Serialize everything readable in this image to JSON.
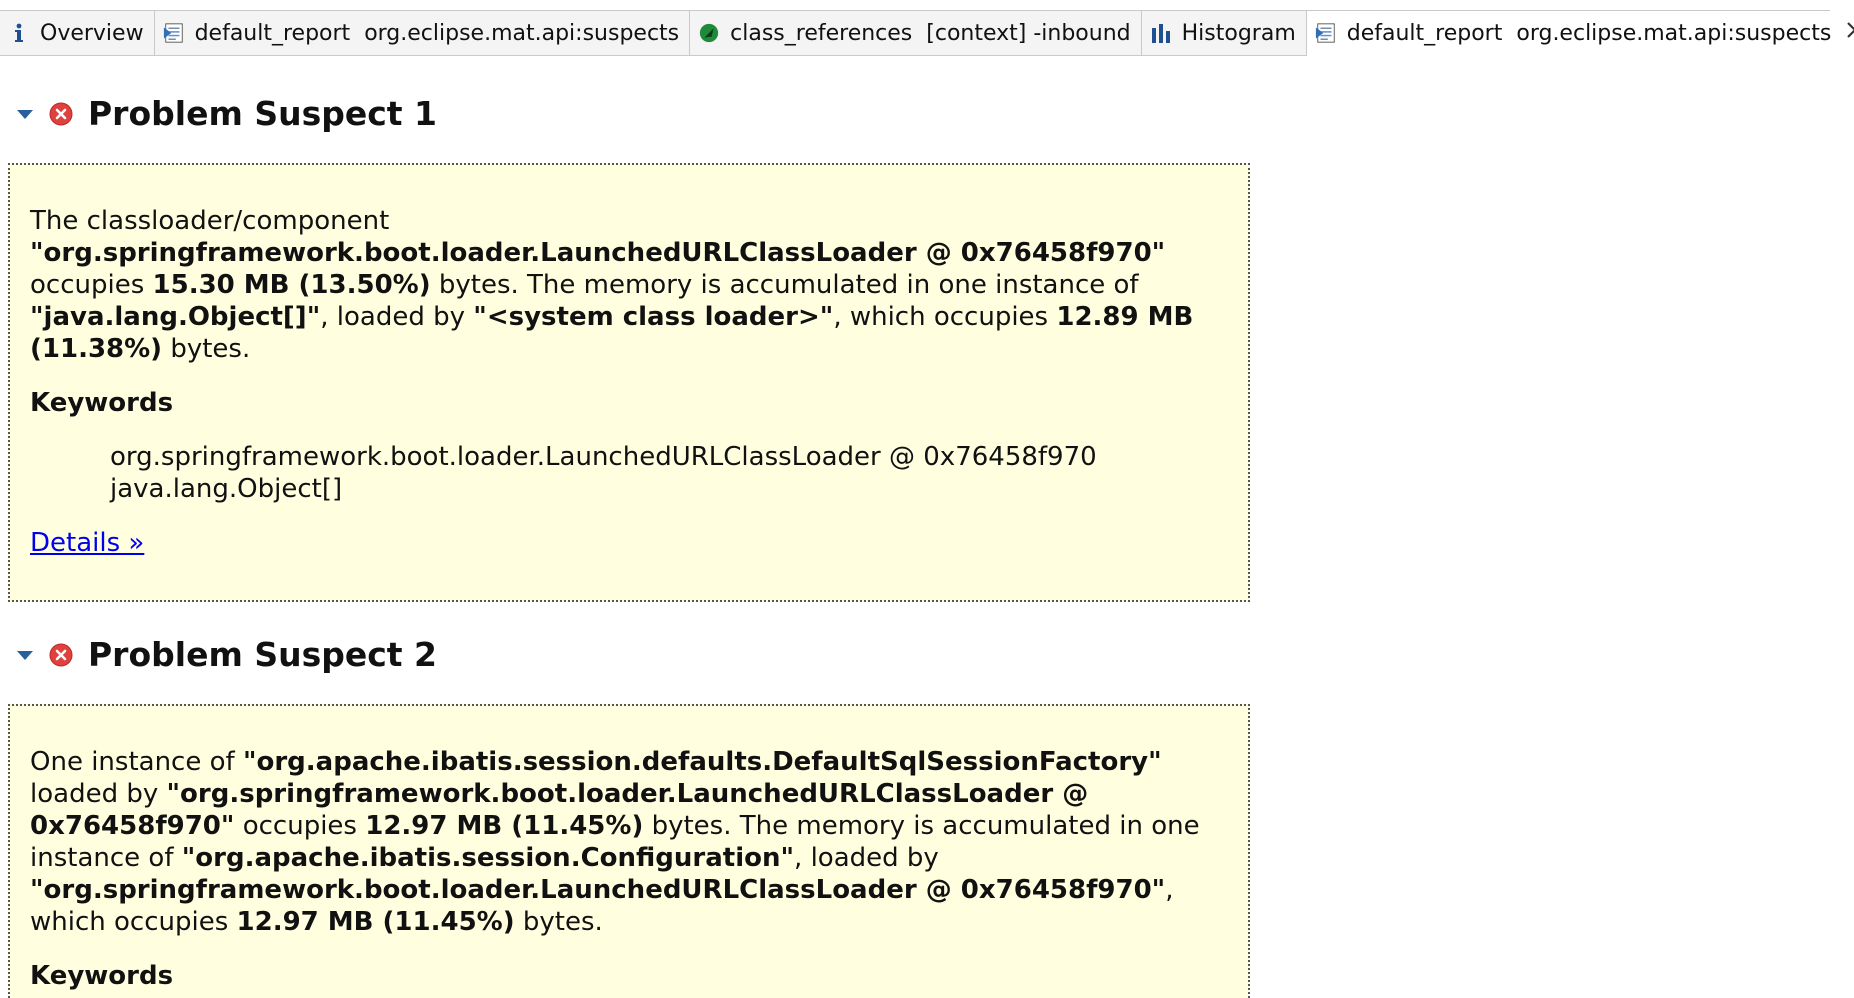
{
  "tabs": [
    {
      "label": "Overview",
      "icon": "info-icon",
      "active": false
    },
    {
      "label": "default_report",
      "label2": "org.eclipse.mat.api:suspects",
      "icon": "report-icon",
      "active": false
    },
    {
      "label": "class_references",
      "label2": "[context] -inbound",
      "icon": "oql-icon",
      "active": false
    },
    {
      "label": "Histogram",
      "icon": "histogram-icon",
      "active": false
    },
    {
      "label": "default_report",
      "label2": "org.eclipse.mat.api:suspects",
      "icon": "report-icon",
      "active": true
    }
  ],
  "suspects": [
    {
      "title": "Problem Suspect 1",
      "description": {
        "t1": "The classloader/component ",
        "b1": "\"org.springframework.boot.loader.LaunchedURLClassLoader @ 0x76458f970\"",
        "t2": " occupies ",
        "b2": "15.30 MB (13.50%)",
        "t3": " bytes. The memory is accumulated in one instance of ",
        "b3": "\"java.lang.Object[]\"",
        "t4": ", loaded by ",
        "b4": "\"<system class loader>\"",
        "t5": ", which occupies ",
        "b5": "12.89 MB (11.38%)",
        "t6": " bytes."
      },
      "keywords_label": "Keywords",
      "keywords": [
        "org.springframework.boot.loader.LaunchedURLClassLoader @ 0x76458f970",
        "java.lang.Object[]"
      ],
      "details_link": "Details »"
    },
    {
      "title": "Problem Suspect 2",
      "description": {
        "t1": "One instance of ",
        "b1": "\"org.apache.ibatis.session.defaults.DefaultSqlSessionFactory\"",
        "t2": " loaded by ",
        "b2": "\"org.springframework.boot.loader.LaunchedURLClassLoader @ 0x76458f970\"",
        "t3": " occupies ",
        "b3": "12.97 MB (11.45%)",
        "t4": " bytes. The memory is accumulated in one instance of ",
        "b4": "\"org.apache.ibatis.session.Configuration\"",
        "t5": ", loaded by ",
        "b5": "\"org.springframework.boot.loader.LaunchedURLClassLoader @ 0x76458f970\"",
        "t6": ", which occupies ",
        "b6": "12.97 MB (11.45%)",
        "t7": " bytes."
      },
      "keywords_label": "Keywords"
    }
  ],
  "colors": {
    "box_bg": "#ffffe0",
    "error_red": "#e0413f",
    "link": "#0000ee",
    "twisty_blue": "#2a5f9e"
  }
}
